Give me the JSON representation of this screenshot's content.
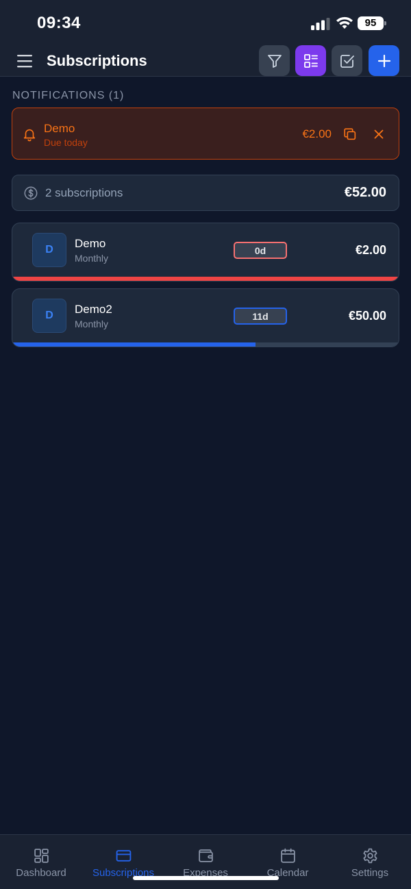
{
  "status_bar": {
    "time": "09:34",
    "battery": "95"
  },
  "header": {
    "title": "Subscriptions"
  },
  "notifications": {
    "label": "NOTIFICATIONS (1)",
    "items": [
      {
        "title": "Demo",
        "subtitle": "Due today",
        "amount": "€2.00"
      }
    ]
  },
  "summary": {
    "count_text": "2 subscriptions",
    "total": "€52.00"
  },
  "subscriptions": [
    {
      "initial": "D",
      "name": "Demo",
      "cycle": "Monthly",
      "days_badge": "0d",
      "amount": "€2.00",
      "progress": 1.0,
      "accent_color": "#ef4444"
    },
    {
      "initial": "D",
      "name": "Demo2",
      "cycle": "Monthly",
      "days_badge": "11d",
      "amount": "€50.00",
      "progress": 0.63,
      "accent_color": "#2563eb"
    }
  ],
  "tabs": [
    {
      "label": "Dashboard",
      "icon": "dashboard-icon",
      "active": false
    },
    {
      "label": "Subscriptions",
      "icon": "credit-card-icon",
      "active": true
    },
    {
      "label": "Expenses",
      "icon": "wallet-icon",
      "active": false
    },
    {
      "label": "Calendar",
      "icon": "calendar-icon",
      "active": false
    },
    {
      "label": "Settings",
      "icon": "gear-icon",
      "active": false
    }
  ],
  "colors": {
    "background": "#0f172a",
    "accent_blue": "#2563eb",
    "accent_purple": "#7c3aed",
    "notification_orange": "#f97316"
  }
}
